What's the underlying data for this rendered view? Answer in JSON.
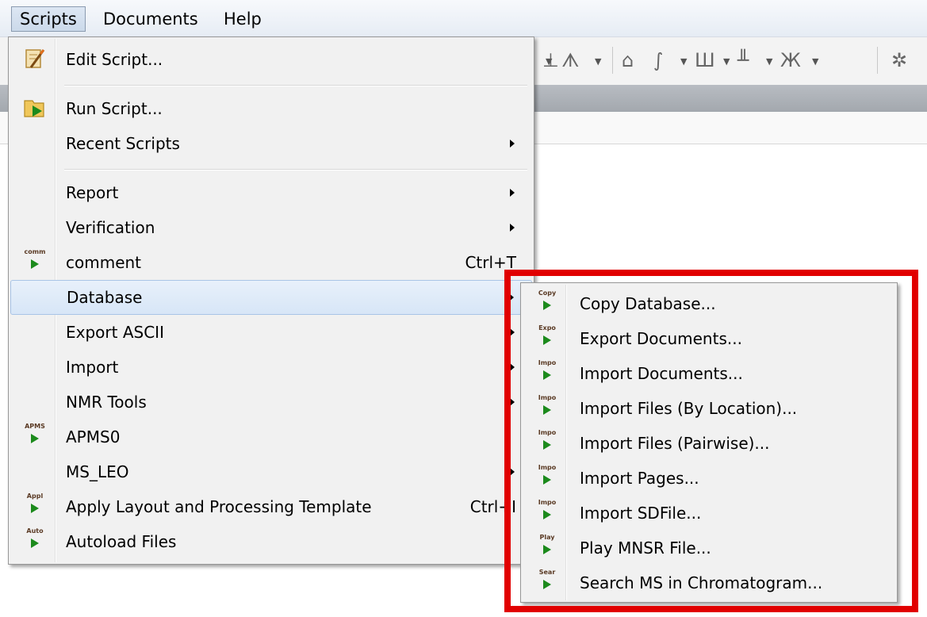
{
  "menubar": {
    "items": [
      {
        "label": "Scripts",
        "active": true
      },
      {
        "label": "Documents",
        "active": false
      },
      {
        "label": "Help",
        "active": false
      }
    ]
  },
  "toolbar": {
    "icons": [
      "peak-tool-icon",
      "tms-reference-icon",
      "integral-tool-icon",
      "multiplet-tool-icon",
      "baseline-tool-icon",
      "phase-tool-icon",
      "gsd-icon"
    ]
  },
  "scripts_menu": {
    "items": [
      {
        "label": "Edit Script...",
        "icon": "edit-script-icon"
      },
      {
        "label": "Run Script...",
        "icon": "run-script-icon"
      },
      {
        "label": "Recent Scripts",
        "submenu": true
      },
      {
        "label": "Report",
        "submenu": true
      },
      {
        "label": "Verification",
        "submenu": true
      },
      {
        "label": "comment",
        "icon": "script-icon",
        "icon_text": "comm",
        "shortcut": "Ctrl+T"
      },
      {
        "label": "Database",
        "submenu": true,
        "highlighted": true
      },
      {
        "label": "Export ASCII",
        "submenu": true
      },
      {
        "label": "Import",
        "submenu": true
      },
      {
        "label": "NMR Tools",
        "submenu": true
      },
      {
        "label": "APMS0",
        "icon": "script-icon",
        "icon_text": "APMS"
      },
      {
        "label": "MS_LEO",
        "submenu": true
      },
      {
        "label": "Apply Layout and Processing Template",
        "icon": "script-icon",
        "icon_text": "Appl",
        "shortcut": "Ctrl+I"
      },
      {
        "label": "Autoload Files",
        "icon": "script-icon",
        "icon_text": "Auto"
      }
    ]
  },
  "database_submenu": {
    "items": [
      {
        "label": "Copy Database...",
        "icon_text": "Copy"
      },
      {
        "label": "Export Documents...",
        "icon_text": "Expo"
      },
      {
        "label": "Import Documents...",
        "icon_text": "Impo"
      },
      {
        "label": "Import Files (By Location)...",
        "icon_text": "Impo"
      },
      {
        "label": "Import Files (Pairwise)...",
        "icon_text": "Impo"
      },
      {
        "label": "Import Pages...",
        "icon_text": "Impo"
      },
      {
        "label": "Import SDFile...",
        "icon_text": "Impo"
      },
      {
        "label": "Play MNSR File...",
        "icon_text": "Play"
      },
      {
        "label": "Search MS in Chromatogram...",
        "icon_text": "Sear"
      }
    ]
  },
  "colors": {
    "highlight_box": "#e10000",
    "menu_bg": "#f1f1f1",
    "hover_bg": "#d7e6f7",
    "play_icon": "#1c8a1c"
  }
}
